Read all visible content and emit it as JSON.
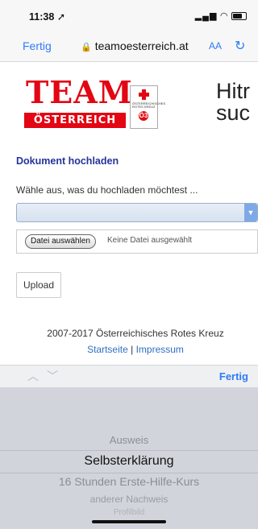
{
  "status": {
    "time": "11:38",
    "signal": "▂▄▆",
    "wifi": "◠"
  },
  "browser": {
    "done_label": "Fertig",
    "url": "teamoesterreich.at",
    "text_size": "AA",
    "reload_icon": "↻"
  },
  "logo": {
    "title": "TEAM",
    "subtitle": "ÖSTERREICH",
    "badge_text": "ÖSTERREICHISCHES ROTES KREUZ",
    "badge_logo": "Ö3"
  },
  "hero": {
    "line1": "Hitr",
    "line2": "suc"
  },
  "form": {
    "heading": "Dokument hochladen",
    "prompt": "Wähle aus, was du hochladen möchtest ...",
    "select_value": "",
    "file_button": "Datei auswählen",
    "file_status": "Keine Datei ausgewählt",
    "upload_label": "Upload"
  },
  "footer": {
    "copyright": "2007-2017 Österreichisches Rotes Kreuz",
    "link_home": "Startseite",
    "separator": " | ",
    "link_imprint": "Impressum"
  },
  "accessory": {
    "prev_icon": "︿",
    "next_icon": "﹀",
    "done_label": "Fertig"
  },
  "picker": {
    "options": [
      "Ausweis",
      "Selbsterklärung",
      "16 Stunden Erste-Hilfe-Kurs",
      "anderer Nachweis",
      "Profilbild"
    ],
    "selected": "Selbsterklärung"
  },
  "colors": {
    "accent": "#2f7bf6",
    "brand_red": "#e30613",
    "heading_blue": "#24349a"
  }
}
